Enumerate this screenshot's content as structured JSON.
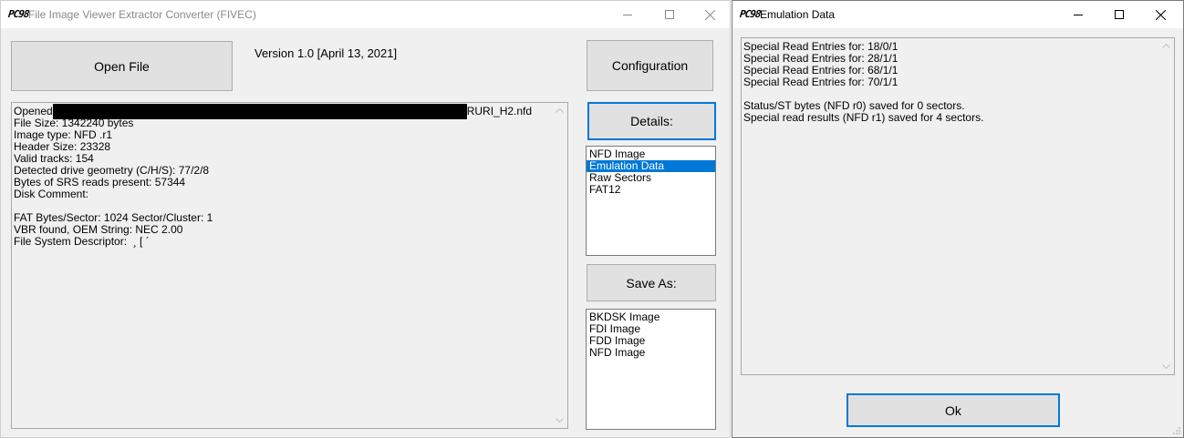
{
  "main_window": {
    "title": "File Image Viewer Extractor Converter (FIVEC)",
    "icon": "PC98",
    "open_file_label": "Open File",
    "version": "Version  1.0 [April 13, 2021]",
    "configuration_label": "Configuration",
    "details_label": "Details:",
    "save_as_label": "Save As:",
    "info": {
      "opened_prefix": "Opened",
      "opened_suffix": "RURI_H2.nfd",
      "lines": [
        "File Size: 1342240 bytes",
        "Image type: NFD .r1",
        "Header Size: 23328",
        "Valid tracks: 154",
        "Detected drive geometry (C/H/S): 77/2/8",
        "Bytes of SRS reads present: 57344",
        "Disk Comment:",
        "",
        "FAT Bytes/Sector: 1024 Sector/Cluster: 1",
        "VBR found, OEM String: NEC 2.00",
        "File System Descriptor:  ¸ [ ´"
      ]
    },
    "details_list": [
      "NFD Image",
      "Emulation Data",
      "Raw Sectors",
      "FAT12"
    ],
    "details_selected": 1,
    "save_list": [
      "BKDSK Image",
      "FDI Image",
      "FDD Image",
      "NFD Image"
    ]
  },
  "emulation_window": {
    "title": "Emulation Data",
    "icon": "PC98",
    "lines": [
      "Special Read Entries for: 18/0/1",
      "Special Read Entries for: 28/1/1",
      "Special Read Entries for: 68/1/1",
      "Special Read Entries for: 70/1/1",
      "",
      "Status/ST bytes (NFD r0) saved for 0 sectors.",
      "Special read results (NFD r1) saved for 4 sectors."
    ],
    "ok_label": "Ok"
  },
  "colors": {
    "accent": "#0078d7",
    "window_bg": "#f0f0f0",
    "button_bg": "#e1e1e1"
  }
}
